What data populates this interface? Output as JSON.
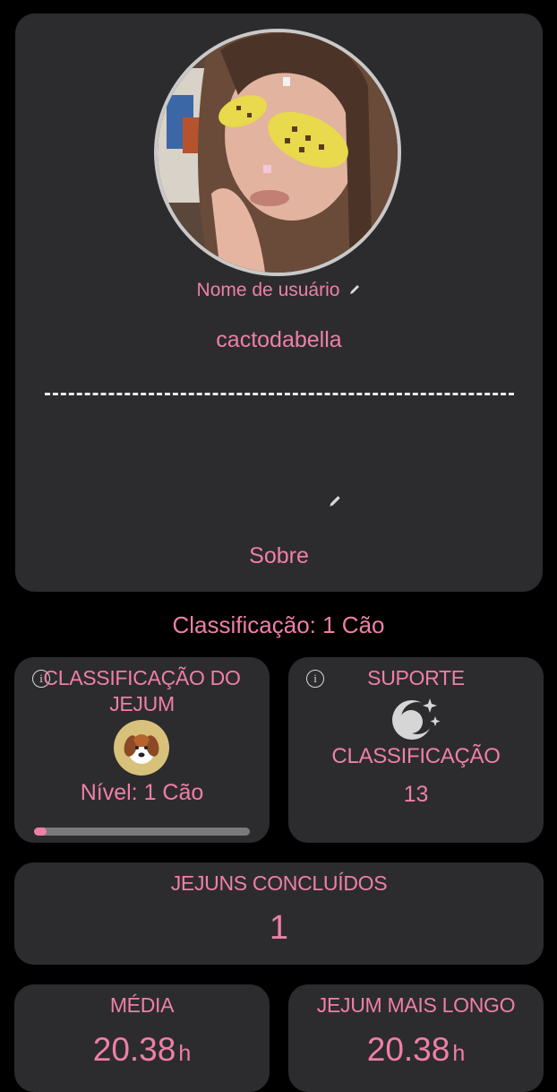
{
  "profile": {
    "username_label": "Nome de usuário",
    "username": "cactodabella",
    "about_label": "Sobre"
  },
  "ranking_line": "Classificação: 1 Cão",
  "fasting_rank": {
    "title": "CLASSIFICAÇÃO DO JEJUM",
    "icon": "dog-icon",
    "level": "Nível: 1 Cão",
    "progress": 0.06
  },
  "support": {
    "title": "SUPORTE",
    "icon": "moon-stars-icon",
    "subtitle": "CLASSIFICAÇÃO",
    "value": "13"
  },
  "completed": {
    "title": "JEJUNS CONCLUÍDOS",
    "value": "1"
  },
  "average": {
    "title": "MÉDIA",
    "value": "20.38",
    "unit": "h"
  },
  "longest": {
    "title": "JEJUM MAIS LONGO",
    "value": "20.38",
    "unit": "h"
  },
  "colors": {
    "accent": "#ef7fa8",
    "card": "#2c2c2e",
    "background": "#000000"
  }
}
